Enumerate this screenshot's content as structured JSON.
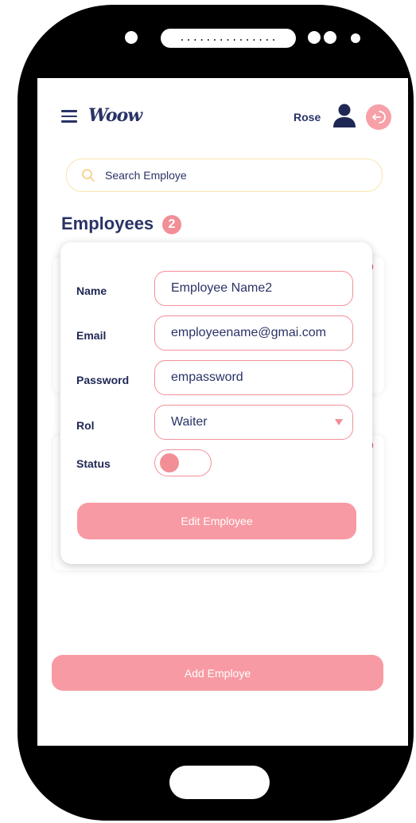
{
  "device": {
    "speaker_text": "..............."
  },
  "header": {
    "logo": "Woow",
    "user_name": "Rose",
    "icons": {
      "menu": "hamburger-menu-icon",
      "avatar": "user-avatar-icon",
      "logout": "logout-icon"
    }
  },
  "search": {
    "placeholder": "Search Employe",
    "value": ""
  },
  "employees": {
    "title": "Employees",
    "count": "2"
  },
  "edit_form": {
    "name_label": "Name",
    "name_value": "Employee Name2",
    "email_label": "Email",
    "email_value": "employeename@gmai.com",
    "password_label": "Password",
    "password_value": "empassword",
    "role_label": "Rol",
    "role_value": "Waiter",
    "status_label": "Status",
    "status_on": false,
    "submit_label": "Edit Employee"
  },
  "footer": {
    "add_label": "Add Employe"
  },
  "colors": {
    "accent": "#f89aa3",
    "accent_strong": "#f28e96",
    "text_dark": "#2a3366",
    "search_border": "#fbe3b0"
  }
}
